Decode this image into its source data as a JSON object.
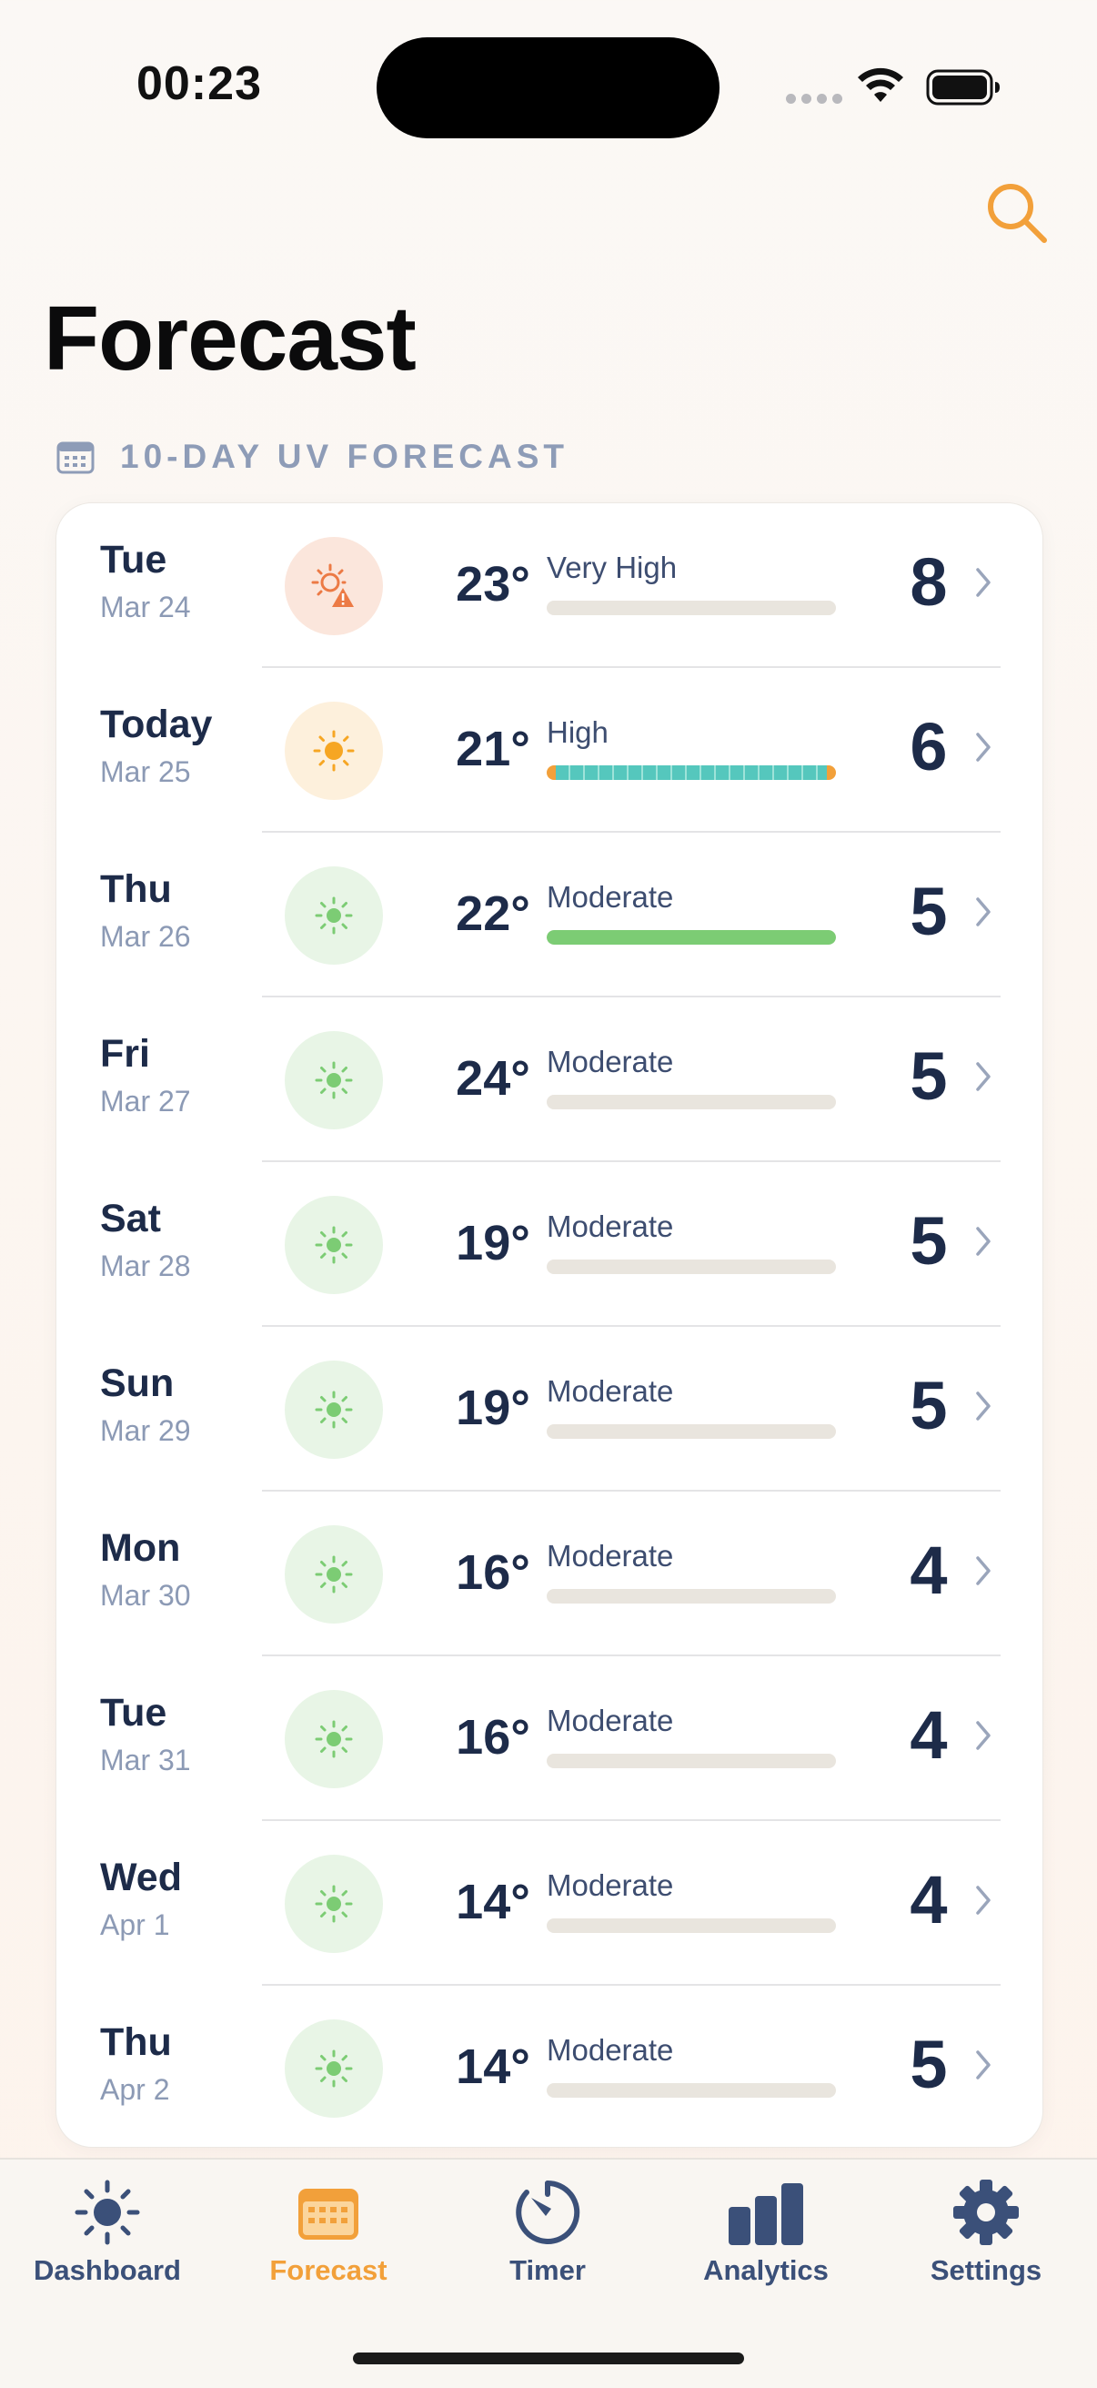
{
  "status_bar": {
    "time": "00:23"
  },
  "page": {
    "title": "Forecast"
  },
  "section": {
    "label": "10-DAY UV FORECAST",
    "icon": "calendar-icon"
  },
  "colors": {
    "accent": "#f2a03a",
    "tab_inactive": "#3b5079",
    "moderate": "#7ccc74",
    "high": "#55c7bd",
    "very_high": "#ec7a45",
    "bar_track": "#e9e5de"
  },
  "forecast": [
    {
      "day": "Tue",
      "date": "Mar 24",
      "temp": "23°",
      "level": "Very High",
      "uv": "8",
      "icon": "sun-warning-icon",
      "bar_fill": 0
    },
    {
      "day": "Today",
      "date": "Mar 25",
      "temp": "21°",
      "level": "High",
      "uv": "6",
      "icon": "sun-icon",
      "bar_fill": 1
    },
    {
      "day": "Thu",
      "date": "Mar 26",
      "temp": "22°",
      "level": "Moderate",
      "uv": "5",
      "icon": "sun-icon",
      "bar_fill": 1
    },
    {
      "day": "Fri",
      "date": "Mar 27",
      "temp": "24°",
      "level": "Moderate",
      "uv": "5",
      "icon": "sun-icon",
      "bar_fill": 0
    },
    {
      "day": "Sat",
      "date": "Mar 28",
      "temp": "19°",
      "level": "Moderate",
      "uv": "5",
      "icon": "sun-icon",
      "bar_fill": 0
    },
    {
      "day": "Sun",
      "date": "Mar 29",
      "temp": "19°",
      "level": "Moderate",
      "uv": "5",
      "icon": "sun-icon",
      "bar_fill": 0
    },
    {
      "day": "Mon",
      "date": "Mar 30",
      "temp": "16°",
      "level": "Moderate",
      "uv": "4",
      "icon": "sun-icon",
      "bar_fill": 0
    },
    {
      "day": "Tue",
      "date": "Mar 31",
      "temp": "16°",
      "level": "Moderate",
      "uv": "4",
      "icon": "sun-icon",
      "bar_fill": 0
    },
    {
      "day": "Wed",
      "date": "Apr 1",
      "temp": "14°",
      "level": "Moderate",
      "uv": "4",
      "icon": "sun-icon",
      "bar_fill": 0
    },
    {
      "day": "Thu",
      "date": "Apr 2",
      "temp": "14°",
      "level": "Moderate",
      "uv": "5",
      "icon": "sun-icon",
      "bar_fill": 0
    }
  ],
  "tabs": [
    {
      "label": "Dashboard",
      "icon": "sun-icon",
      "active": false
    },
    {
      "label": "Forecast",
      "icon": "calendar-icon",
      "active": true
    },
    {
      "label": "Timer",
      "icon": "timer-icon",
      "active": false
    },
    {
      "label": "Analytics",
      "icon": "bar-chart-icon",
      "active": false
    },
    {
      "label": "Settings",
      "icon": "gear-icon",
      "active": false
    }
  ]
}
